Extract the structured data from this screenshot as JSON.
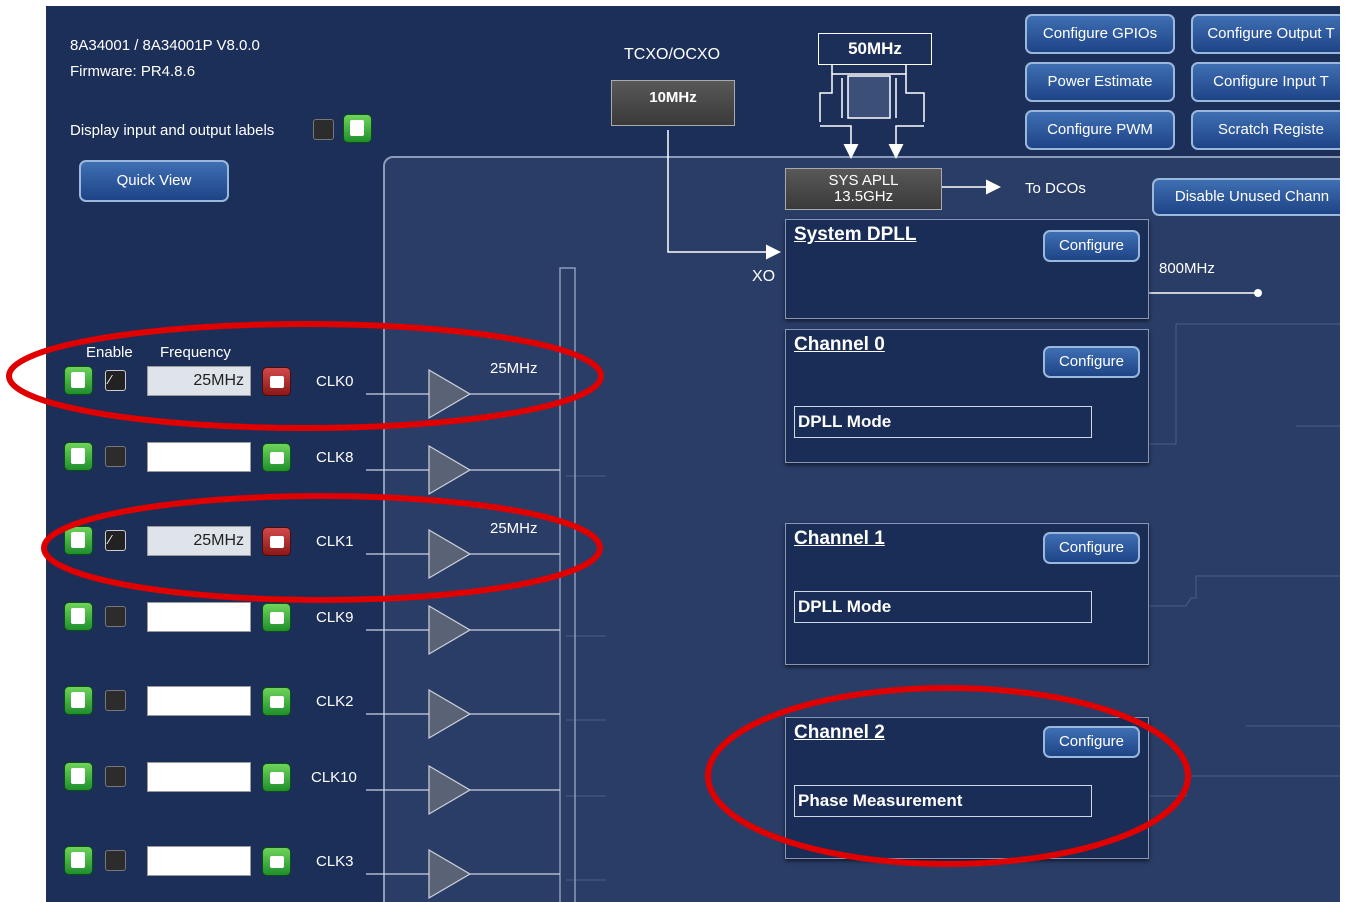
{
  "device": {
    "model": "8A34001 / 8A34001P V8.0.0",
    "firmware": "Firmware: PR4.8.6"
  },
  "display_labels": {
    "label": "Display input and output labels",
    "checked": false
  },
  "quick_view": "Quick View",
  "top_buttons": {
    "configure_gpios": "Configure GPIOs",
    "configure_output": "Configure Output T",
    "power_estimate": "Power Estimate",
    "configure_input": "Configure Input T",
    "configure_pwm": "Configure PWM",
    "scratch_registers": "Scratch Registe",
    "disable_unused": "Disable Unused Chann"
  },
  "oscillator": {
    "title": "TCXO/OCXO",
    "freq": "10MHz"
  },
  "crystal": {
    "freq": "50MHz"
  },
  "sys_apll": {
    "line1": "SYS APLL",
    "line2": "13.5GHz",
    "to_dcos": "To DCOs"
  },
  "xo_label": "XO",
  "inputs_header": {
    "enable": "Enable",
    "frequency": "Frequency"
  },
  "inputs": [
    {
      "name": "CLK0",
      "enabled": true,
      "checked": true,
      "freq": "25MHz",
      "locked": true,
      "annot": "25MHz"
    },
    {
      "name": "CLK8",
      "enabled": true,
      "checked": false,
      "freq": "",
      "locked": false,
      "annot": ""
    },
    {
      "name": "CLK1",
      "enabled": true,
      "checked": true,
      "freq": "25MHz",
      "locked": true,
      "annot": "25MHz"
    },
    {
      "name": "CLK9",
      "enabled": true,
      "checked": false,
      "freq": "",
      "locked": false,
      "annot": ""
    },
    {
      "name": "CLK2",
      "enabled": true,
      "checked": false,
      "freq": "",
      "locked": false,
      "annot": ""
    },
    {
      "name": "CLK10",
      "enabled": true,
      "checked": false,
      "freq": "",
      "locked": false,
      "annot": ""
    },
    {
      "name": "CLK3",
      "enabled": true,
      "checked": false,
      "freq": "",
      "locked": false,
      "annot": ""
    }
  ],
  "system_dpll": {
    "title": "System DPLL",
    "configure": "Configure",
    "out_freq": "800MHz"
  },
  "channels": [
    {
      "title": "Channel 0",
      "configure": "Configure",
      "mode": "DPLL Mode"
    },
    {
      "title": "Channel 1",
      "configure": "Configure",
      "mode": "DPLL Mode"
    },
    {
      "title": "Channel 2",
      "configure": "Configure",
      "mode": "Phase Measurement"
    }
  ],
  "colors": {
    "background": "#1c2f58",
    "panel": "#2a3d67",
    "annotation": "#e00000",
    "lock_open": "#3fb33a",
    "lock_closed": "#b52a2a"
  }
}
